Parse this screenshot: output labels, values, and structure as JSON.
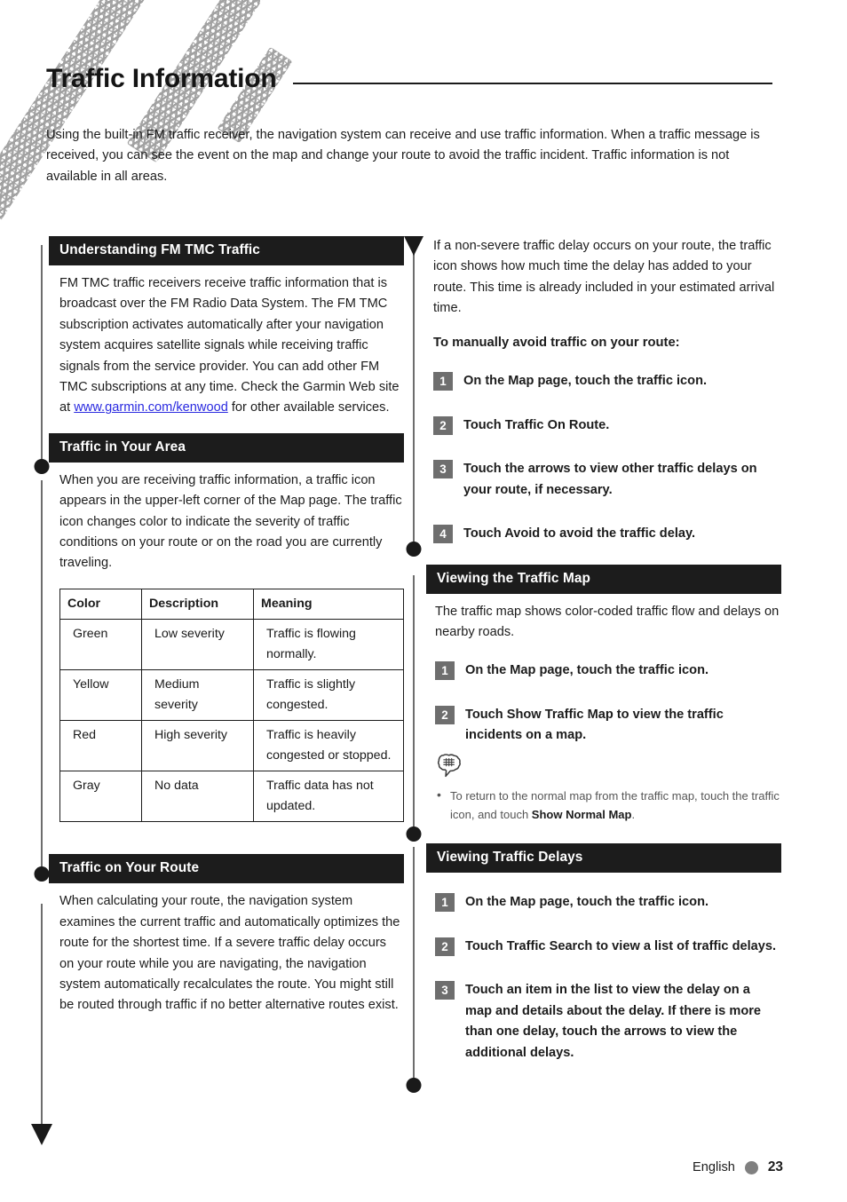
{
  "page": {
    "title": "Traffic Information",
    "intro": "Using the built-in FM traffic receiver, the navigation system can receive and use traffic information. When a traffic message is received, you can see the event on the map and change your route to avoid the traffic incident. Traffic information is not available in all areas."
  },
  "left_column": {
    "sections": [
      {
        "heading": "Understanding FM TMC Traffic",
        "body_before_link": "FM TMC traffic receivers receive traffic information that is broadcast over the FM Radio Data System. The FM TMC subscription activates automatically after your navigation system acquires satellite signals while receiving traffic signals from the service provider. You can add other FM TMC subscriptions at any time. Check the Garmin Web site at ",
        "link_text": "www.garmin.com/kenwood",
        "body_after_link": " for other available services."
      },
      {
        "heading": "Traffic in Your Area",
        "body": "When you are receiving traffic information, a traffic icon appears in the upper-left corner of the Map page. The traffic icon changes color to indicate the severity of traffic conditions on your route or on the road you are currently traveling."
      },
      {
        "heading": "Traffic on Your Route",
        "body": "When calculating your route, the navigation system examines the current traffic and automatically optimizes the route for the shortest time. If a severe traffic delay occurs on your route while you are navigating, the navigation system automatically recalculates the route. You might still be routed through traffic if no better alternative routes exist."
      }
    ],
    "legend_table": {
      "headers": [
        "Color",
        "Description",
        "Meaning"
      ],
      "rows": [
        [
          "Green",
          "Low severity",
          "Traffic is flowing normally."
        ],
        [
          "Yellow",
          "Medium severity",
          "Traffic is slightly congested."
        ],
        [
          "Red",
          "High severity",
          "Traffic is heavily congested or stopped."
        ],
        [
          "Gray",
          "No data",
          "Traffic data has not updated."
        ]
      ]
    }
  },
  "right_column": {
    "intro_paragraph": "If a non-severe traffic delay occurs on your route, the traffic icon shows how much time the delay has added to your route. This time is already included in your estimated arrival time.",
    "procedure_lead": "To manually avoid traffic on your route:",
    "avoid_steps": [
      {
        "num": "1",
        "text": "On the Map page, touch the traffic icon."
      },
      {
        "num": "2",
        "text": "Touch Traffic On Route."
      },
      {
        "num": "3",
        "text": "Touch the arrows to view other traffic delays on your route, if necessary."
      },
      {
        "num": "4",
        "text": "Touch Avoid to avoid the traffic delay."
      }
    ],
    "sections": [
      {
        "heading": "Viewing the Traffic Map",
        "body": "The traffic map shows color-coded traffic flow and delays on nearby roads.",
        "steps": [
          {
            "num": "1",
            "text": "On the Map page, touch the traffic icon."
          },
          {
            "num": "2",
            "text": "Touch Show Traffic Map to view the traffic incidents on a map."
          }
        ],
        "note_prefix": "To return to the normal map from the traffic map, touch the traffic icon, and touch ",
        "note_bold": "Show Normal Map",
        "note_suffix": "."
      },
      {
        "heading": "Viewing Traffic Delays",
        "steps": [
          {
            "num": "1",
            "text": "On the Map page, touch the traffic icon."
          },
          {
            "num": "2",
            "text": "Touch Traffic Search to view a list of traffic delays."
          },
          {
            "num": "3",
            "text": "Touch an item in the list to view the delay on a map and details about the delay. If there is more than one delay, touch the arrows to view the additional delays."
          }
        ]
      }
    ]
  },
  "footer": {
    "language": "English",
    "page_number": "23"
  },
  "colors": {
    "header_bar": "#1c1c1c",
    "step_badge": "#6e6e6e",
    "link": "#2a2ae0",
    "rail": "#6d6d6d",
    "footer_dot": "#808080"
  }
}
